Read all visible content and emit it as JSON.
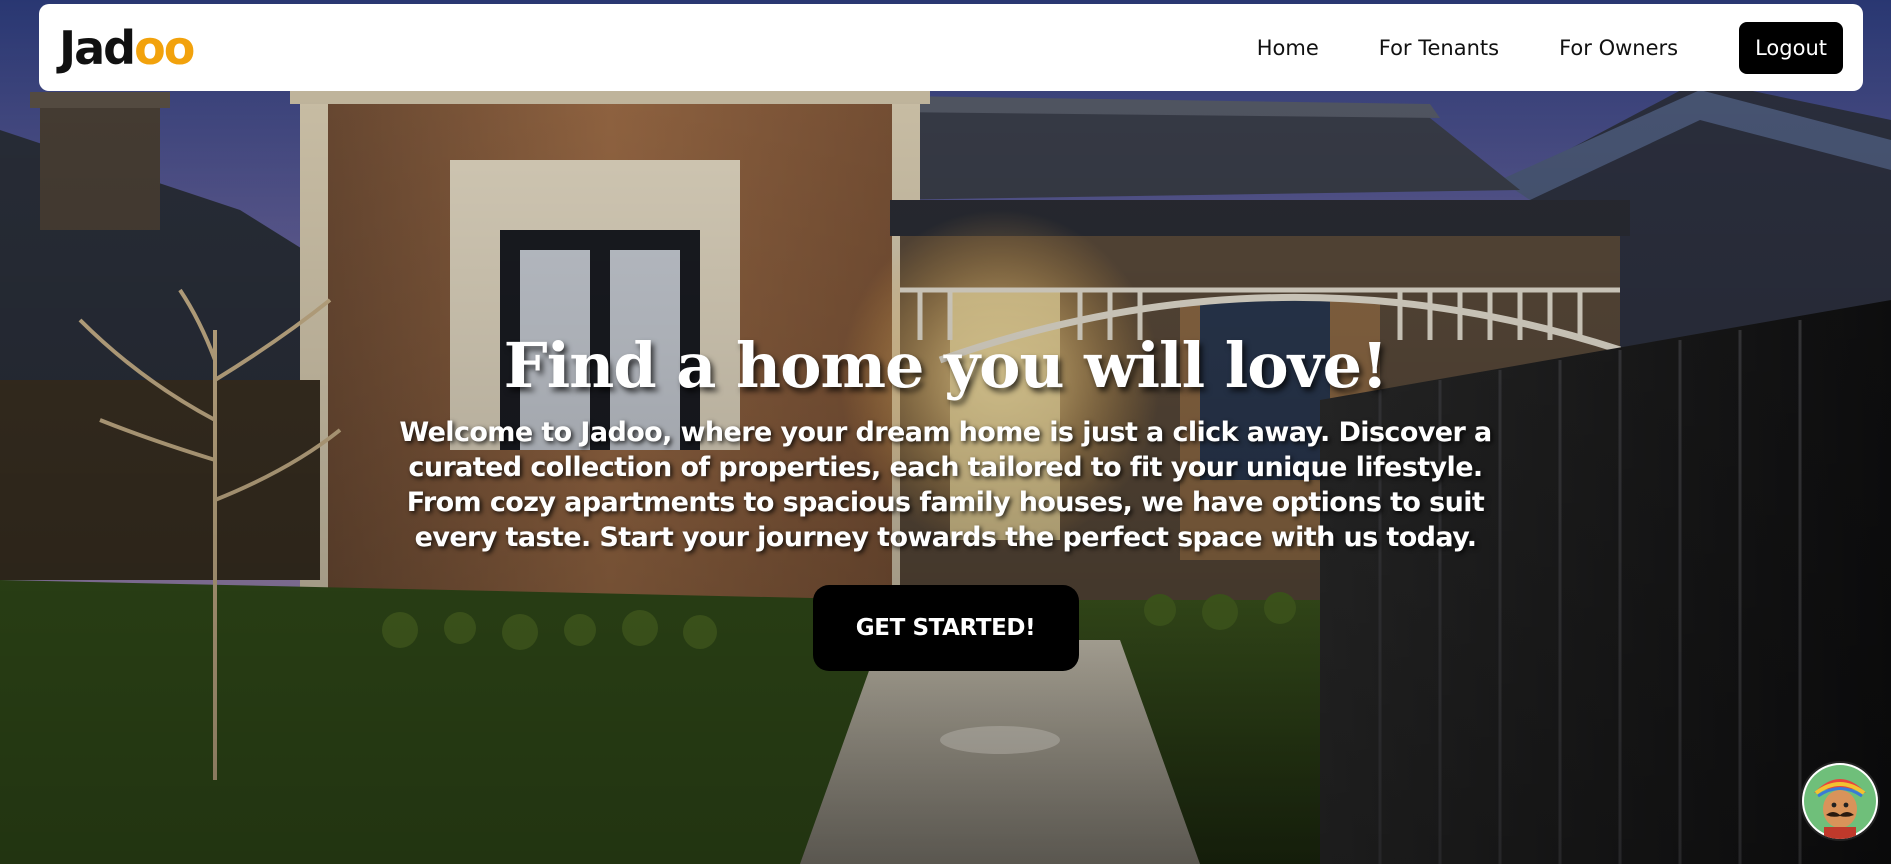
{
  "brand": {
    "logo_prefix": "Jad",
    "logo_accent": "oo",
    "accent_color": "#f2a20c"
  },
  "nav": {
    "links": [
      "Home",
      "For Tenants",
      "For Owners"
    ],
    "logout_label": "Logout"
  },
  "hero": {
    "title": "Find a home you will love!",
    "description": "Welcome to Jadoo, where your dream home is just a click away. Discover a curated collection of properties, each tailored to fit your unique lifestyle. From cozy apartments to spacious family houses, we have options to suit every taste. Start your journey towards the perfect space with us today.",
    "cta_label": "GET STARTED!"
  },
  "assistant": {
    "icon": "chat-assistant-avatar-icon"
  }
}
